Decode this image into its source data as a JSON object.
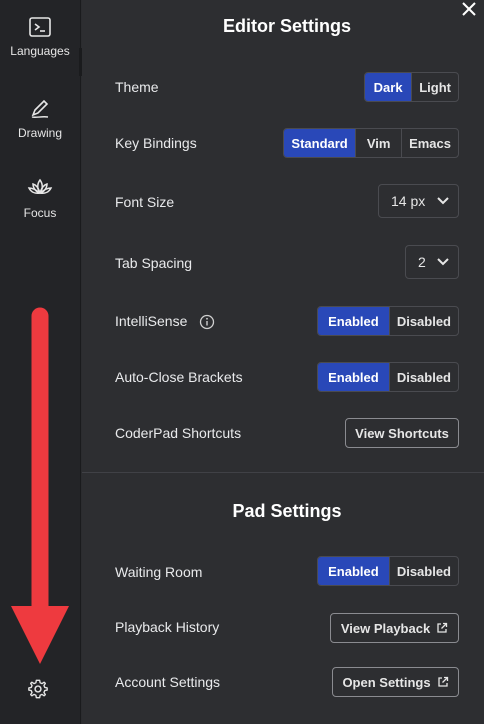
{
  "sidebar": {
    "items": [
      {
        "label": "Languages",
        "icon": "terminal-icon"
      },
      {
        "label": "Drawing",
        "icon": "pen-icon"
      },
      {
        "label": "Focus",
        "icon": "lotus-icon"
      }
    ],
    "settings_icon": "gear-icon"
  },
  "editor_settings": {
    "title": "Editor Settings",
    "theme": {
      "label": "Theme",
      "options": [
        "Dark",
        "Light"
      ],
      "selected": "Dark"
    },
    "key_bindings": {
      "label": "Key Bindings",
      "options": [
        "Standard",
        "Vim",
        "Emacs"
      ],
      "selected": "Standard"
    },
    "font_size": {
      "label": "Font Size",
      "value": "14 px"
    },
    "tab_spacing": {
      "label": "Tab Spacing",
      "value": "2"
    },
    "intellisense": {
      "label": "IntelliSense",
      "options": [
        "Enabled",
        "Disabled"
      ],
      "selected": "Enabled"
    },
    "auto_close": {
      "label": "Auto-Close Brackets",
      "options": [
        "Enabled",
        "Disabled"
      ],
      "selected": "Enabled"
    },
    "shortcuts": {
      "label": "CoderPad Shortcuts",
      "button": "View Shortcuts"
    }
  },
  "pad_settings": {
    "title": "Pad Settings",
    "waiting_room": {
      "label": "Waiting Room",
      "options": [
        "Enabled",
        "Disabled"
      ],
      "selected": "Enabled"
    },
    "playback": {
      "label": "Playback History",
      "button": "View Playback"
    },
    "account": {
      "label": "Account Settings",
      "button": "Open Settings"
    }
  },
  "colors": {
    "accent": "#2948b8",
    "arrow": "#ee3a3f",
    "panel": "#2d2e31",
    "sidebar": "#232427"
  }
}
